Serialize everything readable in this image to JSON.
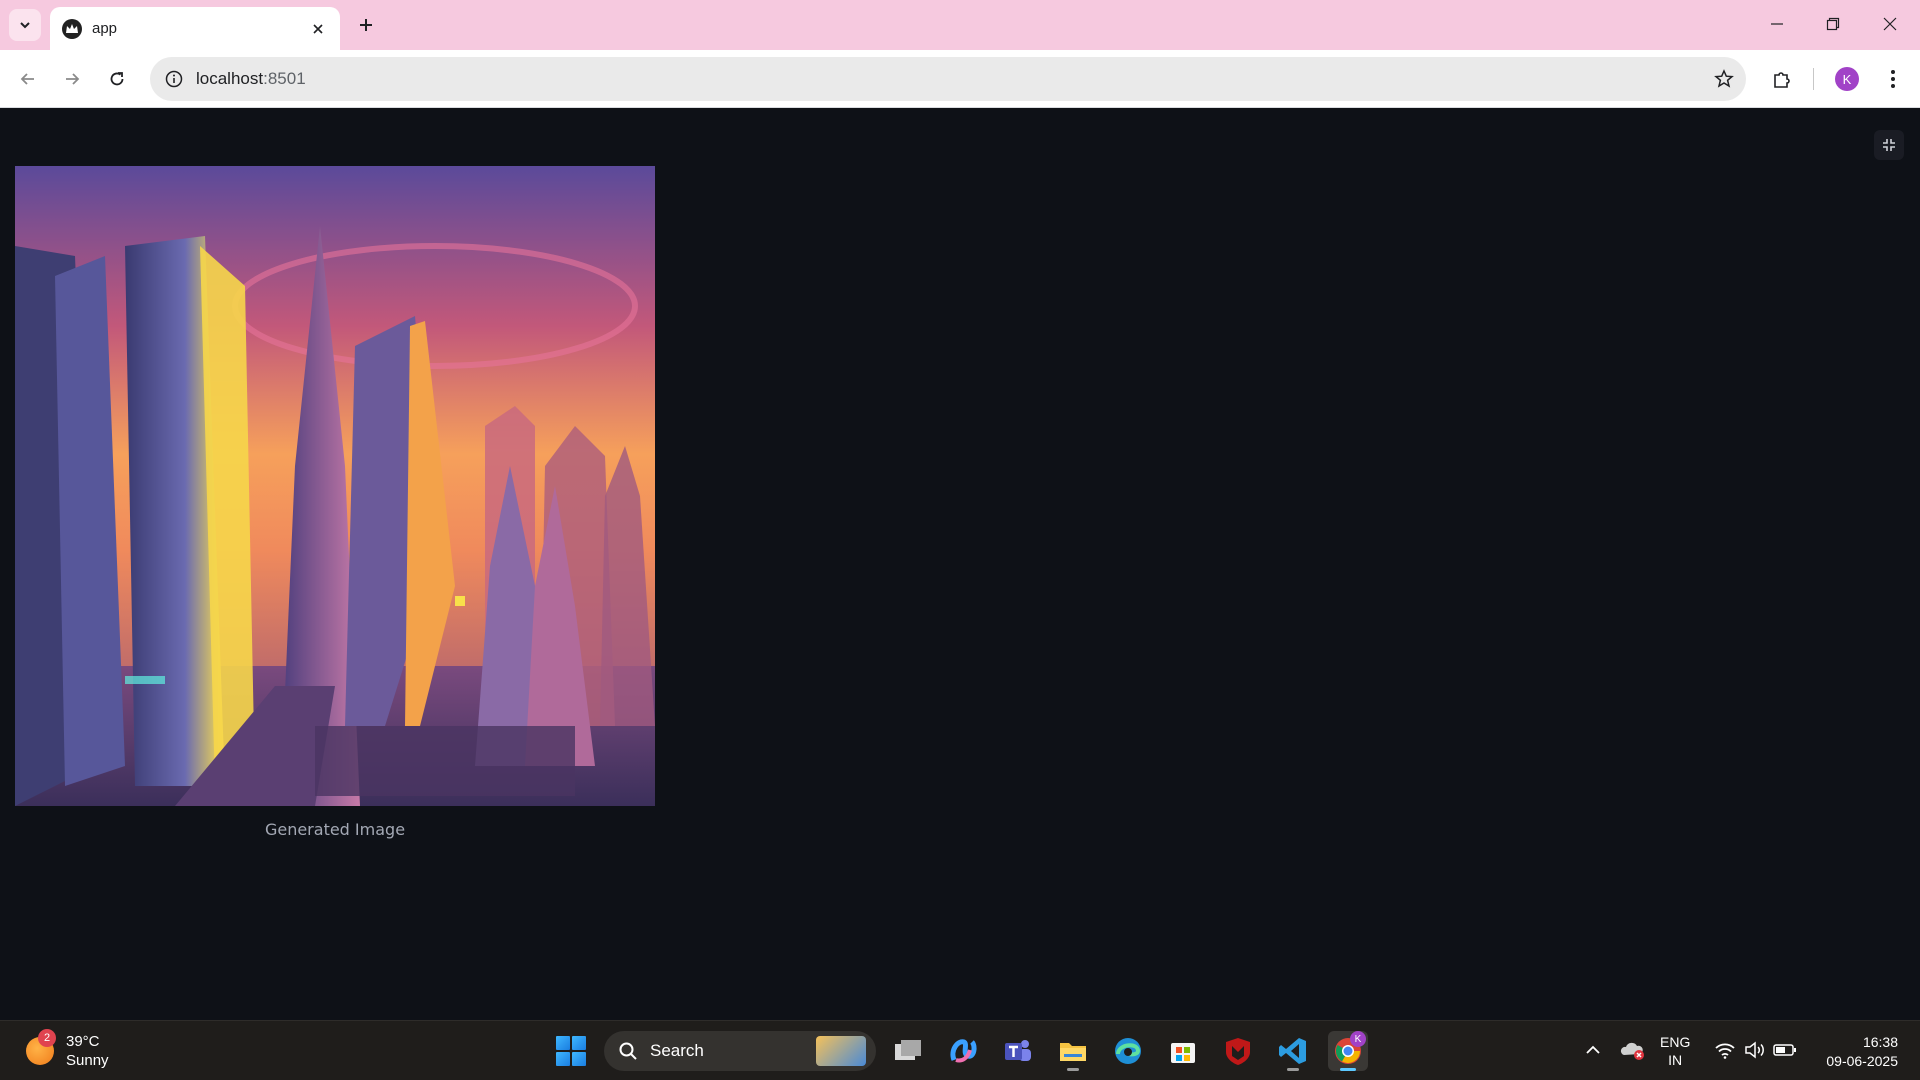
{
  "browser": {
    "tab_title": "app",
    "url_host": "localhost",
    "url_port": ":8501",
    "profile_initial": "K"
  },
  "main": {
    "image_caption": "Generated Image"
  },
  "taskbar": {
    "weather_temp": "39°C",
    "weather_condition": "Sunny",
    "weather_badge": "2",
    "search_label": "Search",
    "chrome_badge": "K",
    "lang_primary": "ENG",
    "lang_secondary": "IN",
    "time": "16:38",
    "date": "09-06-2025"
  },
  "icons": {
    "tab_search": "chevron-down-icon",
    "favicon": "streamlit-crown-icon",
    "close": "close-icon",
    "new_tab": "plus-icon",
    "back": "arrow-left-icon",
    "forward": "arrow-right-icon",
    "reload": "reload-icon",
    "site_info": "info-icon",
    "bookmark": "star-icon",
    "extensions": "puzzle-icon",
    "menu": "kebab-icon",
    "exit_fullscreen": "exit-fullscreen-icon"
  },
  "colors": {
    "tabstrip": "#f6c9df",
    "page_background": "#0e1117",
    "caption_text": "#a3a8b4",
    "profile_avatar": "#a142c7",
    "taskbar": "#1f1d1b"
  }
}
